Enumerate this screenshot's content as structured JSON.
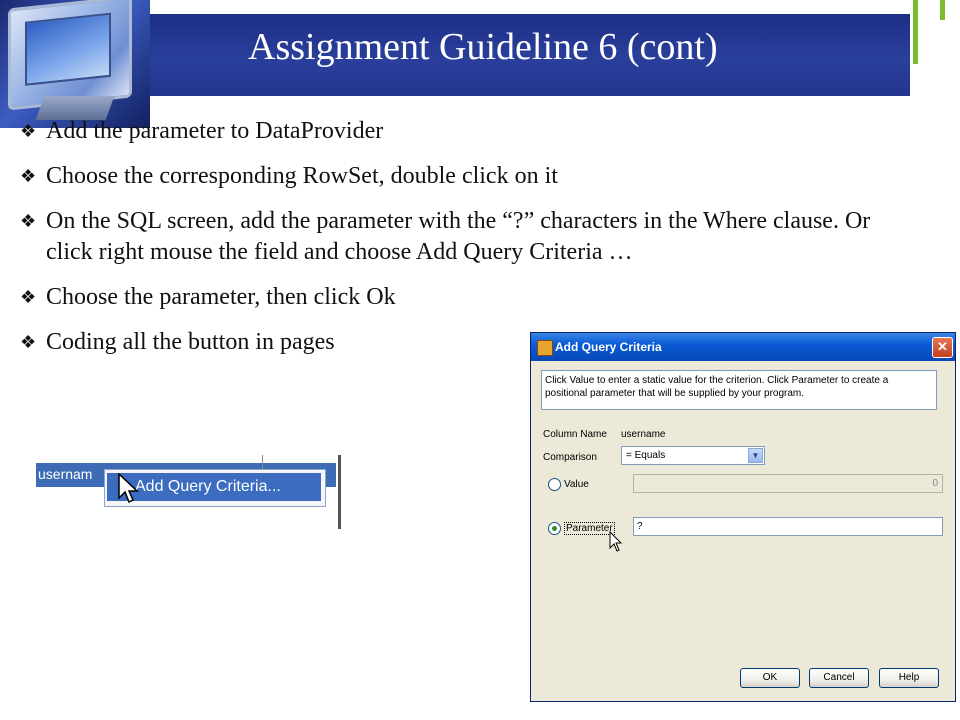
{
  "slide": {
    "title": "Assignment Guideline 6 (cont)",
    "bullets": [
      "Add the parameter to DataProvider",
      "Choose the corresponding RowSet, double click on it",
      "On the SQL screen, add the parameter with the “?” characters in the Where clause. Or click right mouse  the field and choose Add Query Criteria …",
      " Choose the parameter, then click Ok",
      "Coding all the button in pages"
    ],
    "bullet_icon": "❖",
    "colors": {
      "header_band": "#1c2f86",
      "accent_bar": "#7cba2e",
      "title_text": "#ffffff"
    }
  },
  "context_menu": {
    "field_text": "usernam",
    "item_label": "Add Query Criteria..."
  },
  "dialog": {
    "title": "Add Query Criteria",
    "close_glyph": "✕",
    "description": "Click Value to enter a static value for the criterion. Click Parameter to create a positional parameter that will be supplied by your program.",
    "column_name_label": "Column Name",
    "column_name_value": "username",
    "comparison_label": "Comparison",
    "comparison_value": "= Equals",
    "value_label": "Value",
    "value_field": "0",
    "parameter_label": "Parameter",
    "parameter_field": "?",
    "selected_option": "Parameter",
    "buttons": {
      "ok": "OK",
      "cancel": "Cancel",
      "help": "Help"
    }
  }
}
